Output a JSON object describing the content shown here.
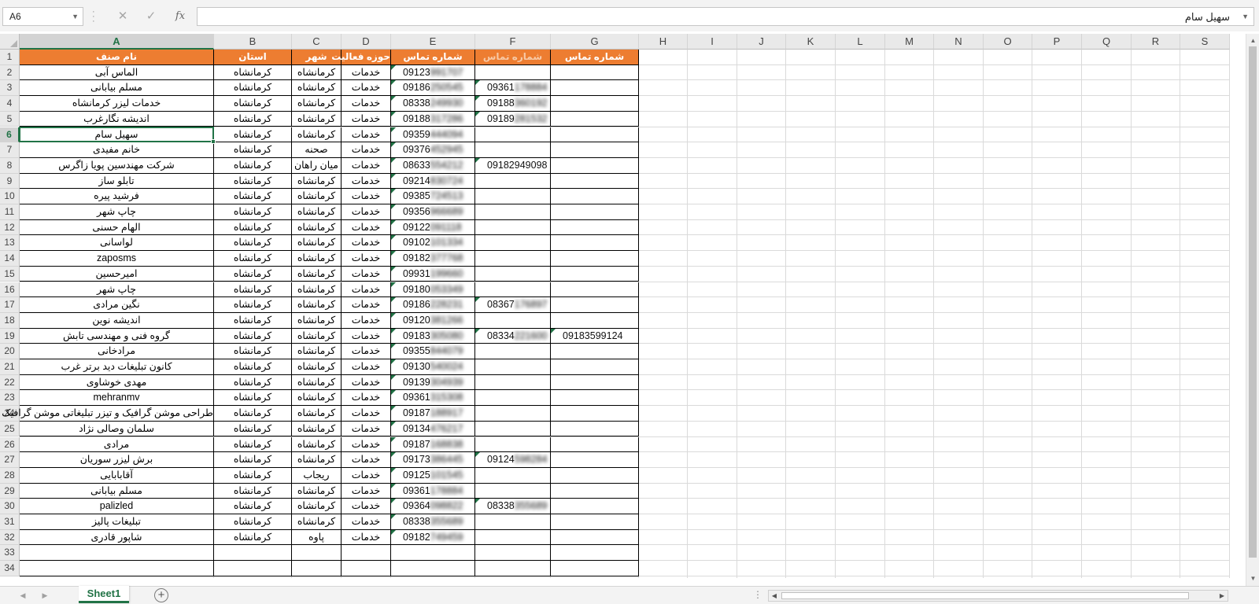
{
  "formula_bar": {
    "name_box": "A6",
    "formula": "سهیل سام",
    "cancel_icon": "✕",
    "enter_icon": "✓",
    "fx_icon": "fx"
  },
  "columns": [
    "A",
    "B",
    "C",
    "D",
    "E",
    "F",
    "G",
    "H",
    "I",
    "J",
    "K",
    "L",
    "M",
    "N",
    "O",
    "P",
    "Q",
    "R",
    "S"
  ],
  "headers": [
    "نام صنف",
    "استان",
    "شهر",
    "حوزه فعالیت",
    "شماره تماس",
    "شماره تماس",
    "شماره تماس"
  ],
  "rows": [
    [
      "الماس آبی",
      "کرمانشاه",
      "کرمانشاه",
      "خدمات",
      "09123991707",
      "",
      ""
    ],
    [
      "مسلم بیابانی",
      "کرمانشاه",
      "کرمانشاه",
      "خدمات",
      "09186250545",
      "09361178884",
      ""
    ],
    [
      "خدمات لیزر کرمانشاه",
      "کرمانشاه",
      "کرمانشاه",
      "خدمات",
      "08338249930",
      "09188360192",
      ""
    ],
    [
      "اندیشه نگارغرب",
      "کرمانشاه",
      "کرمانشاه",
      "خدمات",
      "09188317286",
      "09189281532",
      ""
    ],
    [
      "سهیل سام",
      "کرمانشاه",
      "کرمانشاه",
      "خدمات",
      "09359444094",
      "",
      ""
    ],
    [
      "خانم مفیدی",
      "کرمانشاه",
      "صحنه",
      "خدمات",
      "09376452945",
      "",
      ""
    ],
    [
      "شرکت مهندسین پویا زاگرس",
      "کرمانشاه",
      "میان راهان",
      "خدمات",
      "08633554212",
      "09182949098",
      ""
    ],
    [
      "تابلو ساز",
      "کرمانشاه",
      "کرمانشاه",
      "خدمات",
      "09214830724",
      "",
      ""
    ],
    [
      "فرشید پیره",
      "کرمانشاه",
      "کرمانشاه",
      "خدمات",
      "09385724513",
      "",
      ""
    ],
    [
      "چاپ شهر",
      "کرمانشاه",
      "کرمانشاه",
      "خدمات",
      "09356966689",
      "",
      ""
    ],
    [
      "الهام حسنی",
      "کرمانشاه",
      "کرمانشاه",
      "خدمات",
      "09122091118",
      "",
      ""
    ],
    [
      "لواسانی",
      "کرمانشاه",
      "کرمانشاه",
      "خدمات",
      "09102101334",
      "",
      ""
    ],
    [
      "zaposms",
      "کرمانشاه",
      "کرمانشاه",
      "خدمات",
      "09182377768",
      "",
      ""
    ],
    [
      "امیرحسین",
      "کرمانشاه",
      "کرمانشاه",
      "خدمات",
      "09931199660",
      "",
      ""
    ],
    [
      "چاپ شهر",
      "کرمانشاه",
      "کرمانشاه",
      "خدمات",
      "09180053349",
      "",
      ""
    ],
    [
      "نگین مرادی",
      "کرمانشاه",
      "کرمانشاه",
      "خدمات",
      "09186228231",
      "08367176897",
      ""
    ],
    [
      "اندیشه نوین",
      "کرمانشاه",
      "کرمانشاه",
      "خدمات",
      "09120381266",
      "",
      ""
    ],
    [
      "گروه فنی و مهندسی تابش",
      "کرمانشاه",
      "کرمانشاه",
      "خدمات",
      "09183305080",
      "08334221600",
      "09183599124"
    ],
    [
      "مرادخانی",
      "کرمانشاه",
      "کرمانشاه",
      "خدمات",
      "09355844079",
      "",
      ""
    ],
    [
      "کانون تبلیغات دید برتر غرب",
      "کرمانشاه",
      "کرمانشاه",
      "خدمات",
      "09130540024",
      "",
      ""
    ],
    [
      "مهدی خوشاوی",
      "کرمانشاه",
      "کرمانشاه",
      "خدمات",
      "09139304939",
      "",
      ""
    ],
    [
      "mehranmv",
      "کرمانشاه",
      "کرمانشاه",
      "خدمات",
      "09361315308",
      "",
      ""
    ],
    [
      "طراحی موشن گرافیک و تیزر تبلیغاتی موشن گرافیک",
      "کرمانشاه",
      "کرمانشاه",
      "خدمات",
      "09187188917",
      "",
      ""
    ],
    [
      "سلمان وصالی نژاد",
      "کرمانشاه",
      "کرمانشاه",
      "خدمات",
      "09134476217",
      "",
      ""
    ],
    [
      "مرادی",
      "کرمانشاه",
      "کرمانشاه",
      "خدمات",
      "09187168838",
      "",
      ""
    ],
    [
      "برش لیزر سوریان",
      "کرمانشاه",
      "کرمانشاه",
      "خدمات",
      "09173386445",
      "09124598284",
      ""
    ],
    [
      "آقابابایی",
      "کرمانشاه",
      "ریجاب",
      "خدمات",
      "09125101545",
      "",
      ""
    ],
    [
      "مسلم بیابانی",
      "کرمانشاه",
      "کرمانشاه",
      "خدمات",
      "09361178884",
      "",
      ""
    ],
    [
      "palizled",
      "کرمانشاه",
      "کرمانشاه",
      "خدمات",
      "09364098822",
      "08338355689",
      ""
    ],
    [
      "تبلیغات پالیز",
      "کرمانشاه",
      "کرمانشاه",
      "خدمات",
      "08338355689",
      "",
      ""
    ],
    [
      "شاپور قادری",
      "کرمانشاه",
      "پاوه",
      "خدمات",
      "09182749459",
      "",
      ""
    ]
  ],
  "row_count": 34,
  "sheet_tab": "Sheet1",
  "colors": {
    "header_fill": "#ed7d31",
    "header_text": "#ffffff",
    "accent": "#217346"
  }
}
